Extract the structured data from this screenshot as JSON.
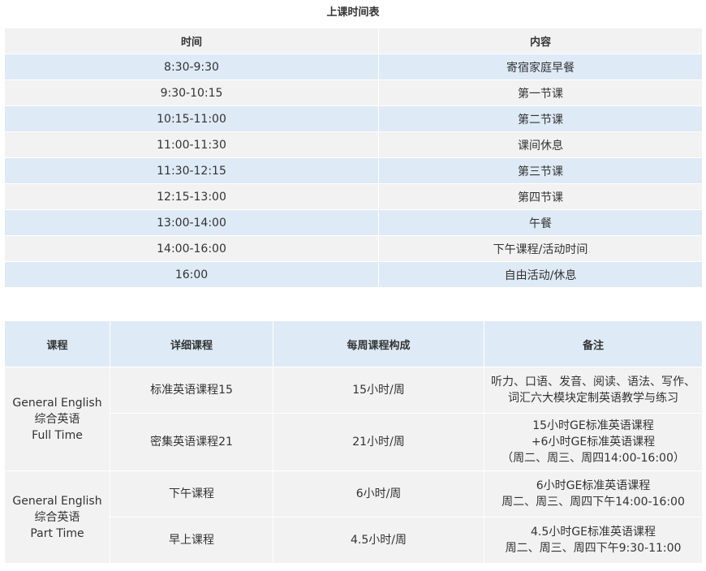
{
  "title": "上课时间表",
  "schedule": {
    "headers": [
      "时间",
      "内容"
    ],
    "rows": [
      {
        "time": "8:30-9:30",
        "content": "寄宿家庭早餐"
      },
      {
        "time": "9:30-10:15",
        "content": "第一节课"
      },
      {
        "time": "10:15-11:00",
        "content": "第二节课"
      },
      {
        "time": "11:00-11:30",
        "content": "课间休息"
      },
      {
        "time": "11:30-12:15",
        "content": "第三节课"
      },
      {
        "time": "12:15-13:00",
        "content": "第四节课"
      },
      {
        "time": "13:00-14:00",
        "content": "午餐"
      },
      {
        "time": "14:00-16:00",
        "content": "下午课程/活动时间"
      },
      {
        "time": "16:00",
        "content": "自由活动/休息"
      }
    ]
  },
  "courses": {
    "headers": [
      "课程",
      "详细课程",
      "每周课程构成",
      "备注"
    ],
    "groups": [
      {
        "name": [
          "General English",
          "综合英语",
          "Full Time"
        ],
        "items": [
          {
            "detail": "标准英语课程15",
            "hours": "15小时/周",
            "notes": [
              "听力、口语、发音、阅读、语法、写作、",
              "词汇六大模块定制英语教学与练习"
            ]
          },
          {
            "detail": "密集英语课程21",
            "hours": "21小时/周",
            "notes": [
              "15小时GE标准英语课程",
              "+6小时GE标准英语课程",
              "（周二、周三、周四14:00-16:00）"
            ]
          }
        ]
      },
      {
        "name": [
          "General English",
          "综合英语",
          "Part Time"
        ],
        "items": [
          {
            "detail": "下午课程",
            "hours": "6小时/周",
            "notes": [
              "6小时GE标准英语课程",
              "周二、周三、周四下午14:00-16:00"
            ]
          },
          {
            "detail": "早上课程",
            "hours": "4.5小时/周",
            "notes": [
              "4.5小时GE标准英语课程",
              "周二、周三、周四下午9:30-11:00"
            ]
          }
        ]
      }
    ]
  }
}
